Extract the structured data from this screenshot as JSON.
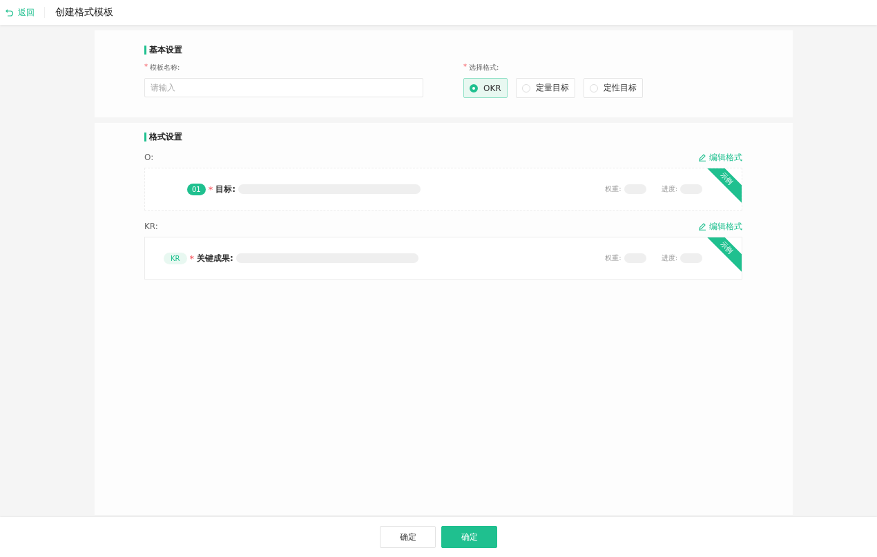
{
  "header": {
    "back": "返回",
    "title": "创建格式模板"
  },
  "basic": {
    "title": "基本设置",
    "name_field": {
      "label": "模板名称:",
      "mark": "*",
      "placeholder": "请输入"
    },
    "format": {
      "label": "选择格式:",
      "mark": "*",
      "options": [
        {
          "label": "OKR",
          "selected": true
        },
        {
          "label": "定量目标",
          "selected": false
        },
        {
          "label": "定性目标",
          "selected": false
        }
      ]
    }
  },
  "format_settings": {
    "title": "格式设置",
    "blocks": [
      {
        "label": "O:",
        "edit": "编辑格式",
        "badge": "01",
        "kind": "number",
        "mark": "*",
        "field": "目标:",
        "weight": "权重:",
        "progress": "进度:",
        "ribbon": "示例"
      },
      {
        "label": "KR:",
        "edit": "编辑格式",
        "badge": "KR",
        "kind": "tag",
        "mark": "*",
        "field": "关键成果:",
        "weight": "权重:",
        "progress": "进度:",
        "ribbon": "示例"
      }
    ]
  },
  "footer": {
    "buttons": [
      {
        "label": "确定",
        "kind": "secondary"
      },
      {
        "label": "确定",
        "kind": "primary"
      }
    ]
  }
}
